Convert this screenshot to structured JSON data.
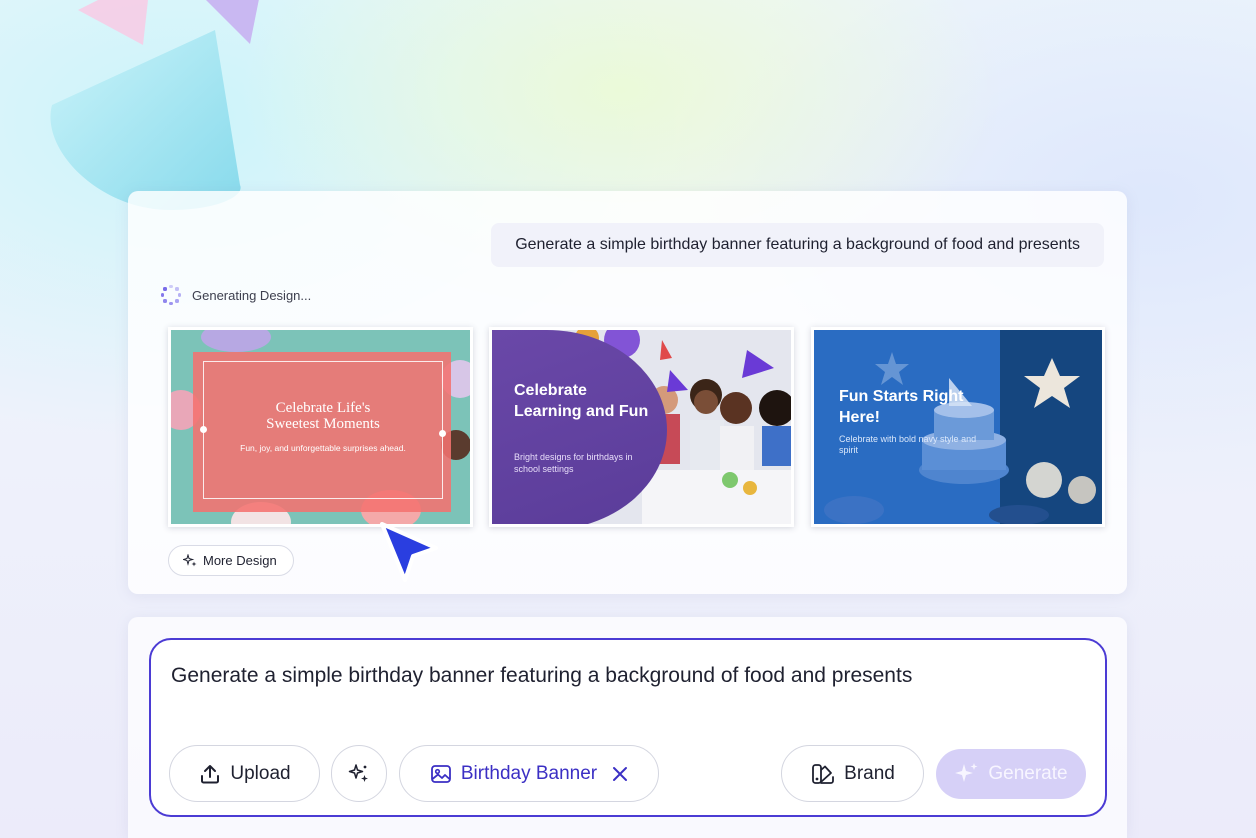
{
  "conversation": {
    "user_prompt": "Generate a simple birthday banner featuring a background of food and presents",
    "status_text": "Generating Design..."
  },
  "designs": [
    {
      "title_line1": "Celebrate Life's",
      "title_line2": "Sweetest Moments",
      "subtitle": "Fun, joy, and unforgettable surprises ahead."
    },
    {
      "title": "Celebrate Learning and Fun",
      "subtitle": "Bright designs for birthdays in school settings"
    },
    {
      "title": "Fun Starts Right Here!",
      "subtitle": "Celebrate with bold navy style and spirit"
    }
  ],
  "more_design_label": "More Design",
  "composer": {
    "input_text": "Generate a simple birthday banner featuring a background of food and presents",
    "upload_label": "Upload",
    "tag_label": "Birthday Banner",
    "brand_label": "Brand",
    "generate_label": "Generate"
  },
  "colors": {
    "accent": "#4b3bd4",
    "tag_text": "#3b2fc4",
    "generate_disabled_bg": "#d6d0f7",
    "cursor": "#2a3ee0"
  },
  "icons": [
    "spinner-icon",
    "sparkle-icon",
    "upload-icon",
    "magic-wand-icon",
    "image-tag-icon",
    "close-icon",
    "brand-palette-icon",
    "cursor-arrow-icon"
  ]
}
